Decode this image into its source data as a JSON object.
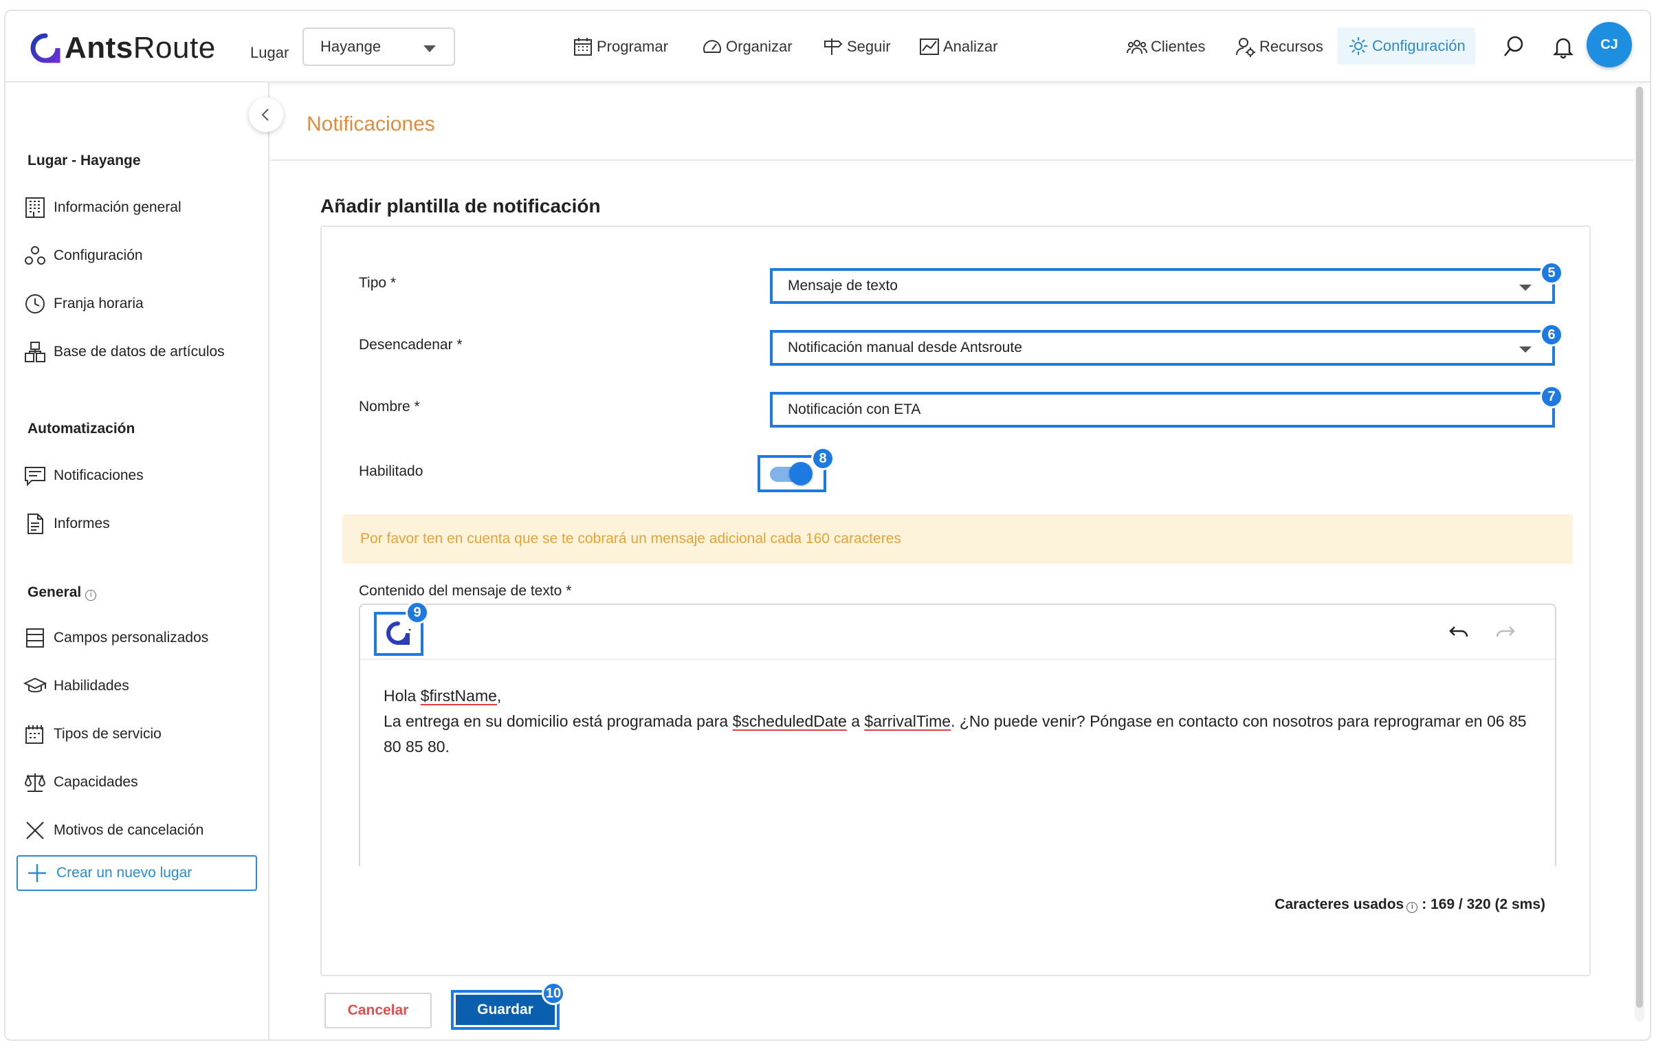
{
  "app": {
    "logo_bold": "Ants",
    "logo_light": "Route"
  },
  "topbar": {
    "place_label": "Lugar",
    "place_value": "Hayange",
    "nav": [
      {
        "label": "Programar",
        "icon": "calendar-icon"
      },
      {
        "label": "Organizar",
        "icon": "gauge-icon"
      },
      {
        "label": "Seguir",
        "icon": "signpost-icon"
      },
      {
        "label": "Analizar",
        "icon": "chart-icon"
      }
    ],
    "right_nav": [
      {
        "label": "Clientes",
        "icon": "users-icon"
      },
      {
        "label": "Recursos",
        "icon": "user-gear-icon"
      },
      {
        "label": "Configuración",
        "icon": "gear-icon",
        "active": true
      }
    ],
    "avatar_initials": "CJ",
    "accent_color": "#2a8bd0"
  },
  "sidebar": {
    "section_place": "Lugar - Hayange",
    "place_items": [
      {
        "label": "Información general",
        "icon": "building-icon"
      },
      {
        "label": "Configuración",
        "icon": "cogs-icon"
      },
      {
        "label": "Franja horaria",
        "icon": "clock-icon"
      },
      {
        "label": "Base de datos de artículos",
        "icon": "boxes-icon"
      }
    ],
    "section_automation": "Automatización",
    "automation_items": [
      {
        "label": "Notificaciones",
        "icon": "message-icon"
      },
      {
        "label": "Informes",
        "icon": "document-icon"
      }
    ],
    "section_general": "General",
    "general_items": [
      {
        "label": "Campos personalizados",
        "icon": "list-icon"
      },
      {
        "label": "Habilidades",
        "icon": "graduation-cap-icon"
      },
      {
        "label": "Tipos de servicio",
        "icon": "service-icon"
      },
      {
        "label": "Capacidades",
        "icon": "scale-icon"
      },
      {
        "label": "Motivos de cancelación",
        "icon": "x-icon"
      }
    ],
    "new_place_label": "Crear un nuevo lugar"
  },
  "main": {
    "page_title": "Notificaciones",
    "form_title": "Añadir plantilla de notificación",
    "fields": {
      "type_label": "Tipo *",
      "type_value": "Mensaje de texto",
      "trigger_label": "Desencadenar *",
      "trigger_value": "Notificación manual desde Antsroute",
      "name_label": "Nombre *",
      "name_value": "Notificación con ETA",
      "enabled_label": "Habilitado",
      "enabled": true
    },
    "badges": [
      "5",
      "6",
      "7",
      "8",
      "9",
      "10"
    ],
    "warning": "Por favor ten en cuenta que se te cobrará un mensaje adicional cada 160 caracteres",
    "editor_label": "Contenido del mensaje de texto *",
    "message": {
      "greeting": "Hola ",
      "var_first_name": "$firstName",
      "greeting_end": ",",
      "line2_a": "La entrega en su domicilio está programada para ",
      "var_scheduled_date": "$scheduledDate",
      "line2_b": " a ",
      "var_arrival_time": "$arrivalTime",
      "line2_c": ". ¿No puede venir? Póngase en contacto con nosotros para reprogramar en 06 85 80 85 80."
    },
    "chars_label": "Caracteres usados",
    "chars_value": ": 169 / 320 (2 sms)",
    "cancel_label": "Cancelar",
    "save_label": "Guardar",
    "highlight_color": "#1d7ae0",
    "warning_color": "#e2a43a"
  }
}
